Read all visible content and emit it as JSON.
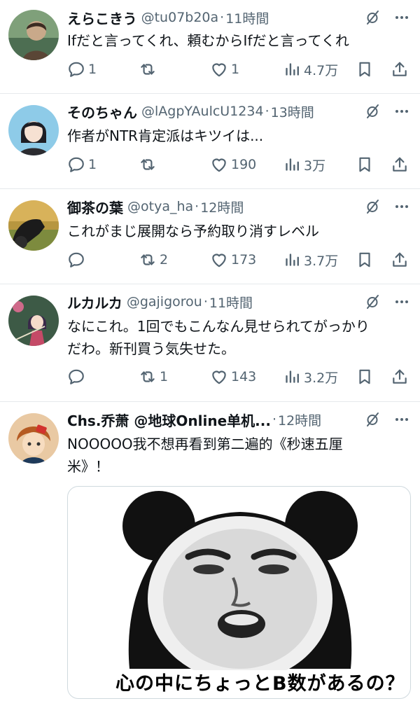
{
  "tweets": [
    {
      "name": "えらこきう",
      "handle": "@tu07b20a",
      "sep": "·",
      "time": "11時間",
      "text": "Ifだと言ってくれ、頼むからIfだと言ってくれ",
      "replies": "1",
      "retweets": "",
      "likes": "1",
      "views": "4.7万"
    },
    {
      "name": "そのちゃん",
      "handle": "@lAgpYAulcU1234",
      "sep": "·",
      "time": "13時間",
      "text": "作者がNTR肯定派はキツイは...",
      "replies": "1",
      "retweets": "",
      "likes": "190",
      "views": "3万"
    },
    {
      "name": "御茶の葉",
      "handle": "@otya_ha",
      "sep": "·",
      "time": "12時間",
      "text": "これがまじ展開なら予約取り消すレベル",
      "replies": "",
      "retweets": "2",
      "likes": "173",
      "views": "3.7万"
    },
    {
      "name": "ルカルカ",
      "handle": "@gajigorou",
      "sep": "·",
      "time": "11時間",
      "text_line1": "なにこれ。1回でもこんなん見せられてがっかり",
      "text_line2": "だわ。新刊買う気失せた。",
      "replies": "",
      "retweets": "1",
      "likes": "143",
      "views": "3.2万"
    },
    {
      "name": "Chs.乔萧 @地球Online单机...",
      "sep": "·",
      "time": "12時間",
      "text_line1": "NOOOOO我不想再看到第二遍的《秒速五厘",
      "text_line2": "米》！",
      "media_caption": "心の中にちょっとB数があるの？"
    }
  ],
  "colors": {
    "text": "#0f1419",
    "secondary": "#536471",
    "divider": "#e6e9ec"
  },
  "icons": [
    "grok-slash-icon",
    "more-icon",
    "reply-icon",
    "retweet-icon",
    "like-icon",
    "views-icon",
    "bookmark-icon",
    "share-icon"
  ]
}
